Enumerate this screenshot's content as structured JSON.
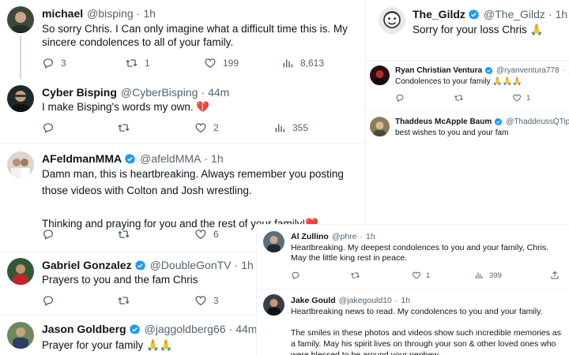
{
  "left": {
    "tweets": [
      {
        "name": "michael",
        "handle": "@bisping",
        "time": "1h",
        "verified": false,
        "text": "So sorry Chris. I Can only imagine what a difficult time this is. My sincere condolences to all of your family.",
        "replies": "3",
        "retweets": "1",
        "likes": "199",
        "views": "8,613"
      },
      {
        "name": "Cyber Bisping",
        "handle": "@CyberBisping",
        "time": "44m",
        "verified": false,
        "text": "I make Bisping's words my own. 💔",
        "replies": "",
        "retweets": "",
        "likes": "2",
        "views": "355"
      },
      {
        "name": "AFeldmanMMA",
        "handle": "@afeldMMA",
        "time": "1h",
        "verified": true,
        "text": "Damn man, this is heartbreaking. Always remember you posting those videos with Colton and Josh wrestling.\n\nThinking and praying for you and the rest of your family!❤️",
        "replies": "",
        "retweets": "",
        "likes": "6",
        "views": ""
      },
      {
        "name": "Gabriel Gonzalez",
        "handle": "@DoubleGonTV",
        "time": "1h",
        "verified": true,
        "text": "Prayers to you and the fam Chris",
        "replies": "",
        "retweets": "",
        "likes": "3",
        "views": ""
      },
      {
        "name": "Jason Goldberg",
        "handle": "@jaggoldberg66",
        "time": "44m",
        "verified": true,
        "text": "Prayer for your family 🙏🙏"
      }
    ]
  },
  "right_top": {
    "main": {
      "name": "The_Gildz",
      "handle": "@The_Gildz",
      "time": "1h",
      "verified": true,
      "text": "Sorry for your loss Chris 🙏"
    },
    "replies": [
      {
        "name": "Ryan Christian Ventura",
        "handle": "@ryanventura778",
        "time": "1h",
        "verified": true,
        "text": "Condolences to your family 🙏🙏🙏",
        "replies": "",
        "retweets": "",
        "likes": "1"
      },
      {
        "name": "Thaddeus McApple Baum",
        "handle": "@ThaddeussQTip",
        "time": "",
        "verified": true,
        "text": "best wishes to you and your fam"
      }
    ]
  },
  "right_bottom": {
    "tweets": [
      {
        "name": "Al Zullino",
        "handle": "@phre",
        "time": "1h",
        "verified": false,
        "text": "Heartbreaking. My deepest condolences to you and your family, Chris. May the little king rest in peace.",
        "replies": "",
        "retweets": "",
        "likes": "1",
        "views": "399"
      },
      {
        "name": "Jake Gould",
        "handle": "@jakegould10",
        "time": "1h",
        "verified": false,
        "text": "Heartbreaking news to read. My condolences to you and your family.\n\nThe smiles in these photos and videos show such incredible memories as a family. May his spirit lives on through your son & other loved ones who were blessed to be around your nephew."
      }
    ]
  },
  "colors": {
    "verified": "#1d9bf0",
    "text": "#0f1419",
    "muted": "#536471",
    "border": "#eff3f4"
  },
  "icons": {
    "reply": "reply-icon",
    "retweet": "retweet-icon",
    "like": "heart-icon",
    "views": "views-icon",
    "share": "share-icon",
    "verified": "verified-badge-icon"
  }
}
